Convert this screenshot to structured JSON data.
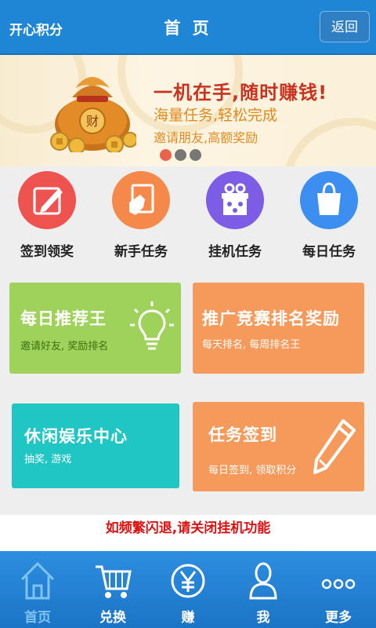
{
  "header": {
    "app_name": "开心积分",
    "title": "首 页",
    "back_label": "返回"
  },
  "banner": {
    "headline": "一机在手,随时赚钱!",
    "line1": "海量任务,轻松完成",
    "line2": "邀请朋友,高额奖励",
    "bag_text": "财",
    "slide_count": 3,
    "active_slide": 1
  },
  "menu": {
    "items": [
      {
        "label": "签到领奖",
        "icon": "edit-pen-icon",
        "color": "#ee5350"
      },
      {
        "label": "新手任务",
        "icon": "hand-pointer-icon",
        "color": "#f5894a"
      },
      {
        "label": "挂机任务",
        "icon": "gift-box-icon",
        "color": "#7d5ce6"
      },
      {
        "label": "每日任务",
        "icon": "shopping-bag-icon",
        "color": "#3c8ef0"
      }
    ]
  },
  "cards": [
    {
      "title": "每日推荐王",
      "subtitle": "邀请好友, 奖励排名",
      "color": "#9fd25a",
      "icon": "lightbulb-icon"
    },
    {
      "title": "推广竞赛排名奖励",
      "subtitle": "每天排名, 每周排名王",
      "color": "#f59a5a",
      "icon": ""
    },
    {
      "title": "休闲娱乐中心",
      "subtitle": "抽奖, 游戏",
      "color": "#1fc6c4",
      "icon": ""
    },
    {
      "title": "任务签到",
      "subtitle": "每日签到, 领取积分",
      "color": "#f59a5a",
      "icon": "pencil-icon"
    }
  ],
  "notice": "如频繁闪退,请关闭挂机功能",
  "tabbar": {
    "items": [
      {
        "label": "首页",
        "icon": "home-icon",
        "active": true
      },
      {
        "label": "兑换",
        "icon": "cart-icon",
        "active": false
      },
      {
        "label": "赚",
        "icon": "yen-coin-icon",
        "active": false
      },
      {
        "label": "我",
        "icon": "person-icon",
        "active": false
      },
      {
        "label": "更多",
        "icon": "more-dots-icon",
        "active": false
      }
    ]
  }
}
